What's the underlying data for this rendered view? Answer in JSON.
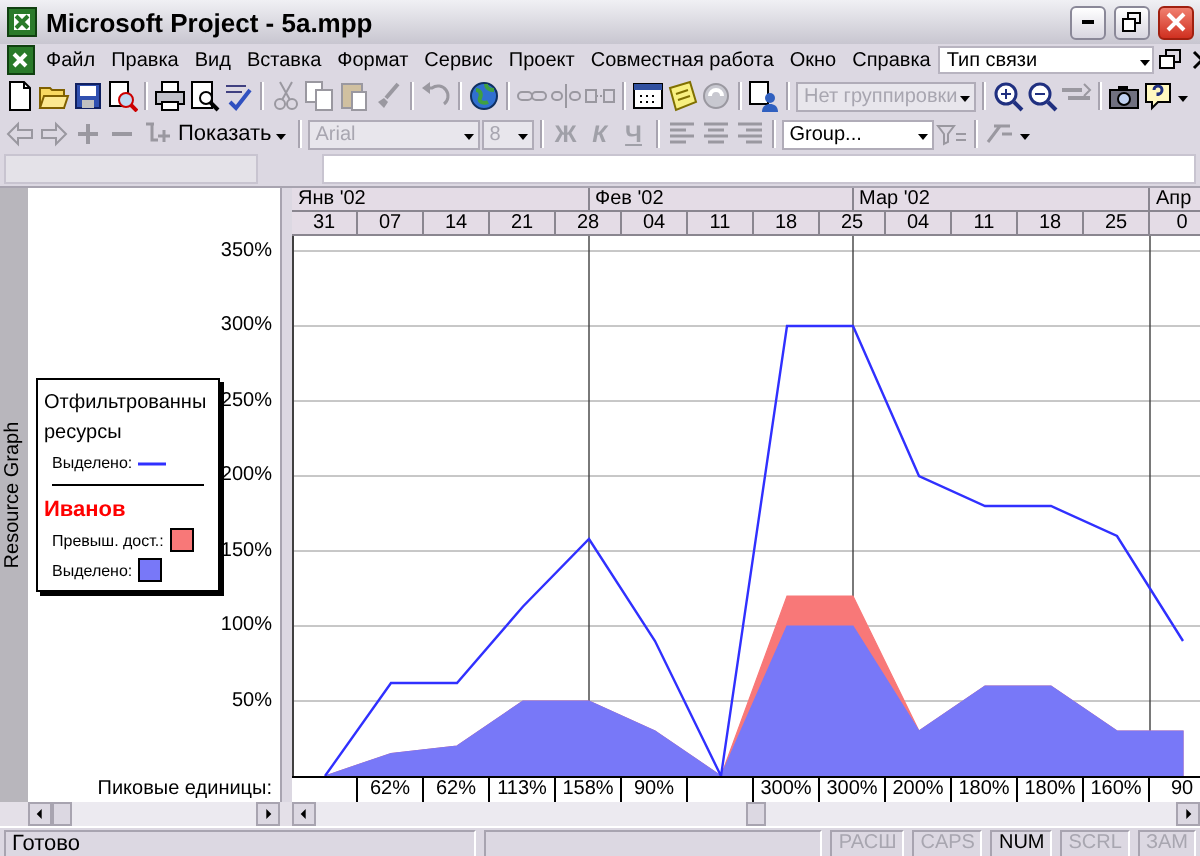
{
  "window": {
    "title": "Microsoft Project - 5a.mpp"
  },
  "menu": {
    "items": [
      "Файл",
      "Правка",
      "Вид",
      "Вставка",
      "Формат",
      "Сервис",
      "Проект",
      "Совместная работа",
      "Окно",
      "Справка"
    ],
    "question_field": {
      "value": "Тип связи"
    }
  },
  "standard_toolbar": {
    "grouping": {
      "value": "Нет группировки",
      "disabled": true
    }
  },
  "formatting_toolbar": {
    "show_button": "Показать",
    "font": {
      "value": "Arial",
      "disabled": true
    },
    "font_size": {
      "value": "8",
      "disabled": true
    },
    "format_buttons": [
      {
        "label": "Ж",
        "disabled": true
      },
      {
        "label": "К",
        "disabled": true
      },
      {
        "label": "Ч",
        "disabled": true
      }
    ],
    "filter": {
      "value": "Group..."
    }
  },
  "view_bar": {
    "label": "Resource Graph"
  },
  "timescale": {
    "months": [
      "Янв '02",
      "Фев '02",
      "Мар '02",
      "Апр"
    ]
  },
  "graph": {
    "chart_data": {
      "type": "area",
      "categories": [
        "31",
        "07",
        "14",
        "21",
        "28",
        "04",
        "11",
        "18",
        "25",
        "04",
        "11",
        "18",
        "25",
        "0"
      ],
      "ylim": [
        0,
        360
      ],
      "yticks": [
        {
          "value": 50,
          "label": "50%"
        },
        {
          "value": 100,
          "label": "100%"
        },
        {
          "value": 150,
          "label": "150%"
        },
        {
          "value": 200,
          "label": "200%"
        },
        {
          "value": 250,
          "label": "250%"
        },
        {
          "value": 300,
          "label": "300%"
        },
        {
          "value": 350,
          "label": "350%"
        }
      ],
      "stacked": false,
      "grid": true,
      "legend": "left",
      "series": [
        {
          "name": "Превыш. дост.:",
          "type": "area",
          "color": "#f87878",
          "values": [
            0,
            15,
            20,
            50,
            50,
            30,
            0,
            120,
            120,
            30,
            60,
            60,
            30,
            30
          ]
        },
        {
          "name": "Выделено:",
          "type": "area",
          "color": "#7878f8",
          "values": [
            0,
            15,
            20,
            50,
            50,
            30,
            0,
            100,
            100,
            30,
            60,
            60,
            30,
            30
          ]
        },
        {
          "name": "Выделено:",
          "type": "line",
          "color": "#3030ff",
          "values": [
            0,
            62,
            62,
            113,
            158,
            90,
            0,
            300,
            300,
            200,
            180,
            180,
            160,
            90
          ]
        }
      ]
    },
    "legend": {
      "title": "Отфильтрованны ресурсы",
      "resource": "Иванов"
    },
    "peak_units": {
      "label": "Пиковые единицы:",
      "cells": [
        {},
        {
          "value": "62%"
        },
        {
          "value": "62%"
        },
        {
          "value": "113%"
        },
        {
          "value": "158%"
        },
        {
          "value": "90%"
        },
        {},
        {
          "value": "300%"
        },
        {
          "value": "300%"
        },
        {
          "value": "200%"
        },
        {
          "value": "180%"
        },
        {
          "value": "180%"
        },
        {
          "value": "160%"
        },
        {
          "value": "90"
        }
      ]
    }
  },
  "status_bar": {
    "text": "Готово",
    "indicators": [
      {
        "label": "РАСШ",
        "on": false
      },
      {
        "label": "CAPS",
        "on": false
      },
      {
        "label": "NUM",
        "on": true
      },
      {
        "label": "SCRL",
        "on": false
      },
      {
        "label": "ЗАМ",
        "on": false
      }
    ]
  }
}
